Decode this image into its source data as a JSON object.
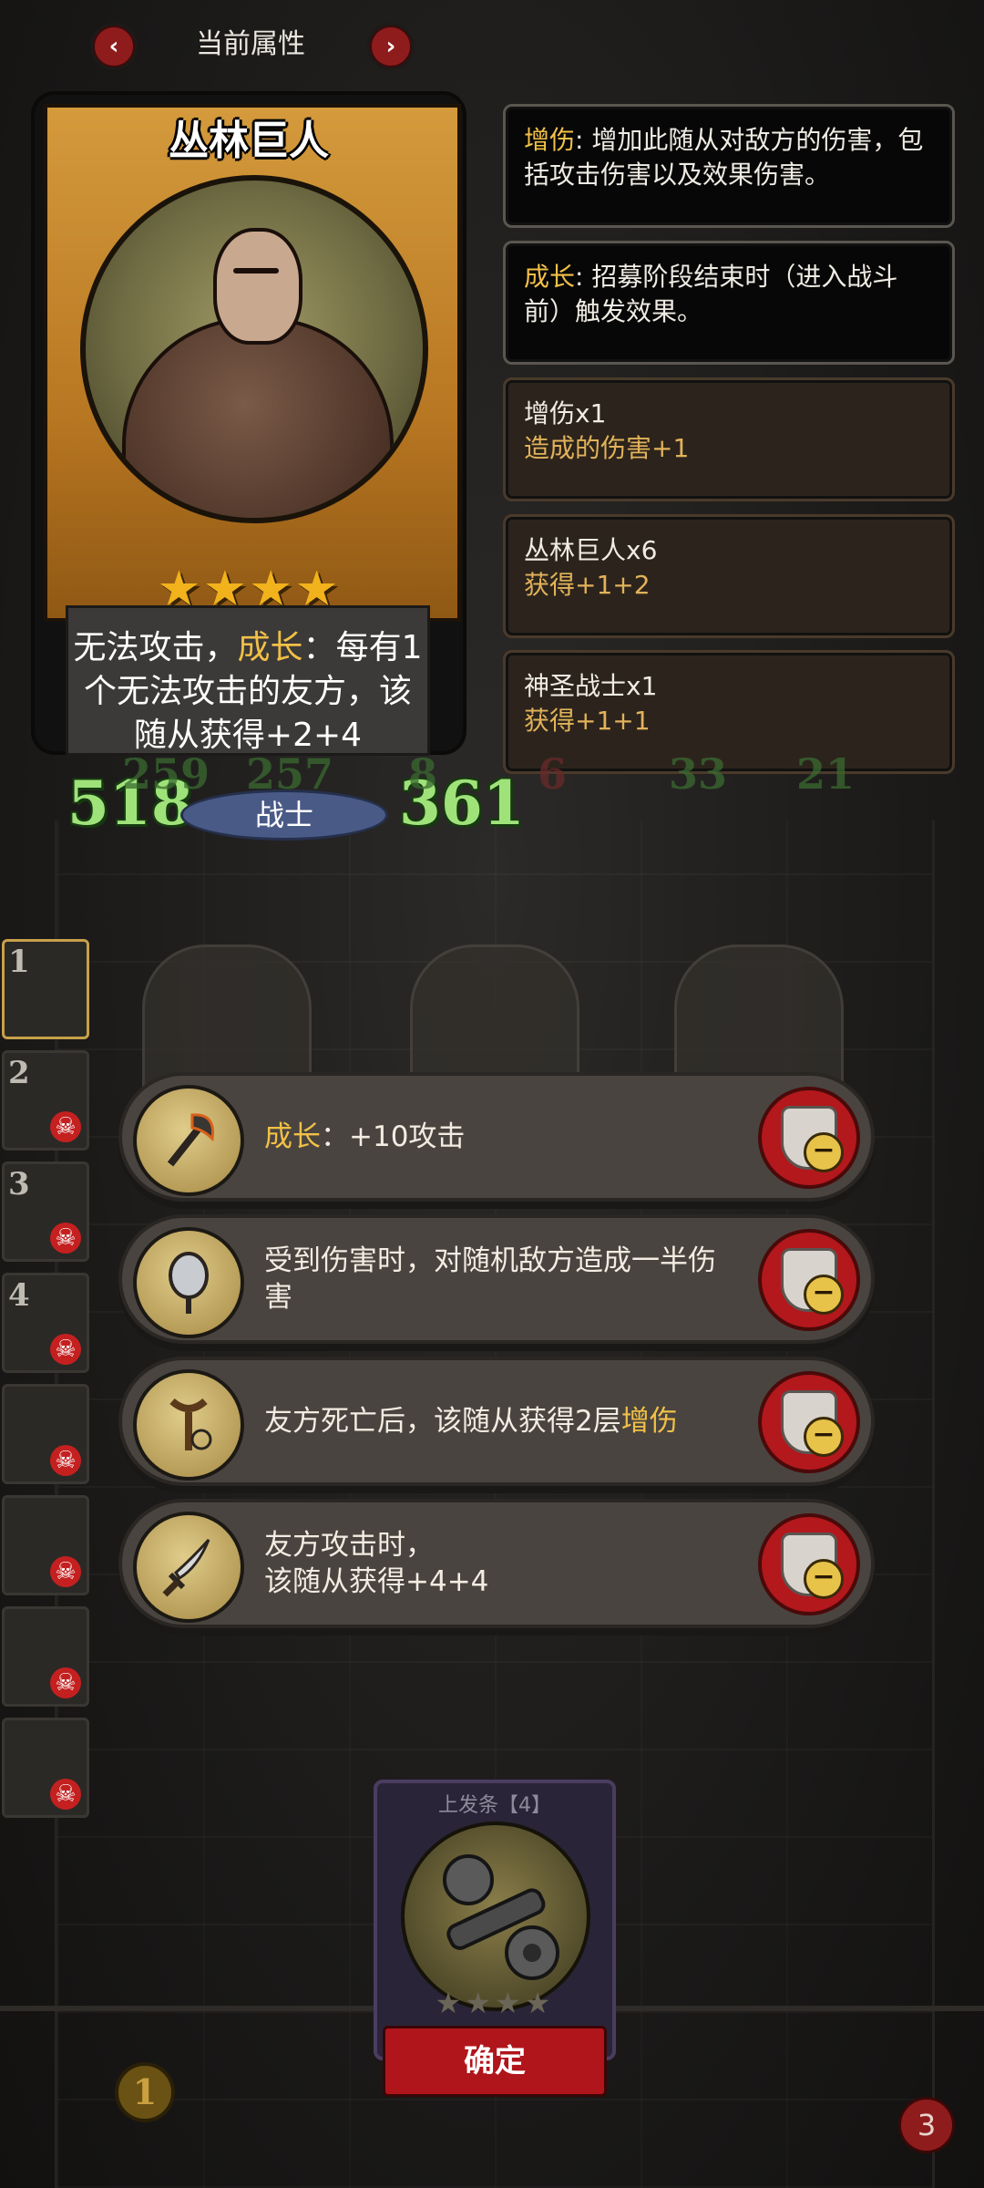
{
  "header": {
    "title": "当前属性",
    "prev_icon": "‹",
    "next_icon": "›"
  },
  "hero": {
    "name": "丛林巨人",
    "stars": 4,
    "stars_text": "★★★★",
    "desc_pre": "无法攻击，",
    "desc_kw": "成长",
    "desc_post": "：每有1个无法攻击的友方，该随从获得+2+4",
    "attack": "518",
    "health": "361",
    "class": "战士"
  },
  "info_panels": [
    {
      "keyword": "增伤",
      "text": ": 增加此随从对敌方的伤害，包括攻击伤害以及效果伤害。"
    },
    {
      "keyword": "成长",
      "text": ": 招募阶段结束时（进入战斗前）触发效果。"
    },
    {
      "line1": "增伤x1",
      "line2": "造成的伤害+1"
    },
    {
      "line1": "丛林巨人x6",
      "line2": "获得+1+2"
    },
    {
      "line1": "神圣战士x1",
      "line2": "获得+1+1"
    }
  ],
  "board": {
    "m1": "259",
    "m2": "257",
    "m3": "8",
    "m4": "6",
    "m5": "33",
    "m6": "21"
  },
  "roster": [
    "1",
    "2",
    "3",
    "4",
    "",
    "",
    "",
    ""
  ],
  "equipment": [
    {
      "keyword": "成长",
      "text": "：+10攻击",
      "icon": "axe-icon"
    },
    {
      "text": "受到伤害时，对随机敌方造成一半伤害",
      "icon": "mirror-icon"
    },
    {
      "text": "友方死亡后，该随从获得2层",
      "keyword_after": "增伤",
      "icon": "slingshot-icon"
    },
    {
      "text": "友方攻击时，",
      "text2": "该随从获得+4+4",
      "icon": "dagger-icon"
    }
  ],
  "bottom_card": {
    "title": "上发条【4】",
    "stars": "★★★★",
    "confirm": "确定"
  },
  "gold": "1",
  "lives": "3",
  "colors": {
    "keyword": "#f2c047",
    "stat_green": "#9fe27a",
    "button_red": "#b0151c"
  }
}
